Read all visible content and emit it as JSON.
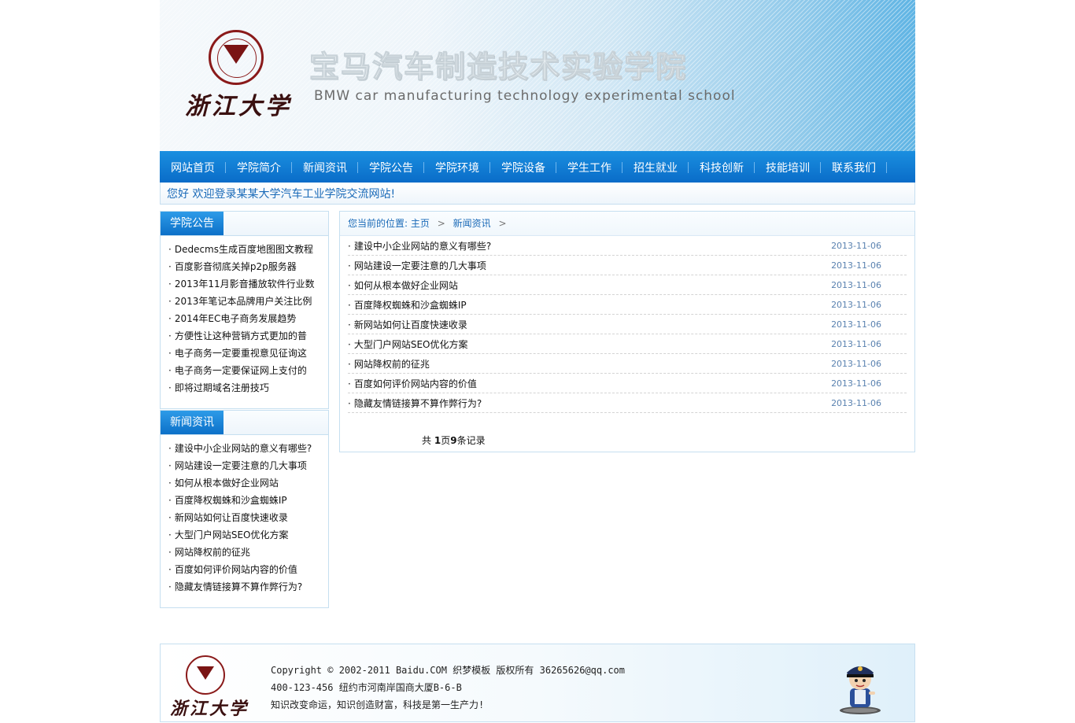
{
  "banner": {
    "logo_text": "浙江大学",
    "title_cn": "宝马汽车制造技术实验学院",
    "title_en": "BMW car manufacturing technology experimental school"
  },
  "nav": {
    "items": [
      "网站首页",
      "学院简介",
      "新闻资讯",
      "学院公告",
      "学院环境",
      "学院设备",
      "学生工作",
      "招生就业",
      "科技创新",
      "技能培训",
      "联系我们"
    ]
  },
  "welcome": "您好 欢迎登录某某大学汽车工业学院交流网站!",
  "sidebar": {
    "notices": {
      "title": "学院公告",
      "items": [
        "Dedecms生成百度地图图文教程",
        "百度影音彻底关掉p2p服务器",
        "2013年11月影音播放软件行业数",
        "2013年笔记本品牌用户关注比例",
        "2014年EC电子商务发展趋势",
        "方便性让这种营销方式更加的普",
        "电子商务一定要重视意见征询这",
        "电子商务一定要保证网上支付的",
        "即将过期域名注册技巧"
      ]
    },
    "news": {
      "title": "新闻资讯",
      "items": [
        "建设中小企业网站的意义有哪些?",
        "网站建设一定要注意的几大事项",
        "如何从根本做好企业网站",
        "百度降权蜘蛛和沙盒蜘蛛IP",
        "新网站如何让百度快速收录",
        "大型门户网站SEO优化方案",
        "网站降权前的征兆",
        "百度如何评价网站内容的价值",
        "隐藏友情链接算不算作弊行为?"
      ]
    }
  },
  "breadcrumb": {
    "prefix": "您当前的位置:",
    "home": "主页",
    "sep": ">",
    "current": "新闻资讯",
    "trail": ">"
  },
  "articles": [
    {
      "title": "建设中小企业网站的意义有哪些?",
      "date": "2013-11-06"
    },
    {
      "title": "网站建设一定要注意的几大事项",
      "date": "2013-11-06"
    },
    {
      "title": "如何从根本做好企业网站",
      "date": "2013-11-06"
    },
    {
      "title": "百度降权蜘蛛和沙盒蜘蛛IP",
      "date": "2013-11-06"
    },
    {
      "title": "新网站如何让百度快速收录",
      "date": "2013-11-06"
    },
    {
      "title": "大型门户网站SEO优化方案",
      "date": "2013-11-06"
    },
    {
      "title": "网站降权前的征兆",
      "date": "2013-11-06"
    },
    {
      "title": "百度如何评价网站内容的价值",
      "date": "2013-11-06"
    },
    {
      "title": "隐藏友情链接算不算作弊行为?",
      "date": "2013-11-06"
    }
  ],
  "pager": {
    "prefix": "共 ",
    "pages": "1",
    "mid": "页",
    "count": "9",
    "suffix": "条记录"
  },
  "footer": {
    "logo_text": "浙江大学",
    "line1": "Copyright © 2002-2011 Baidu.COM 织梦模板 版权所有 36265626@qq.com",
    "line2": "400-123-456 纽约市河南岸国商大厦B-6-B",
    "line3": "知识改变命运，知识创造财富，科技是第一生产力!"
  },
  "colors": {
    "nav_blue": "#0a6cc8",
    "border_blue": "#c6dff0",
    "date_blue": "#5a82b0"
  }
}
